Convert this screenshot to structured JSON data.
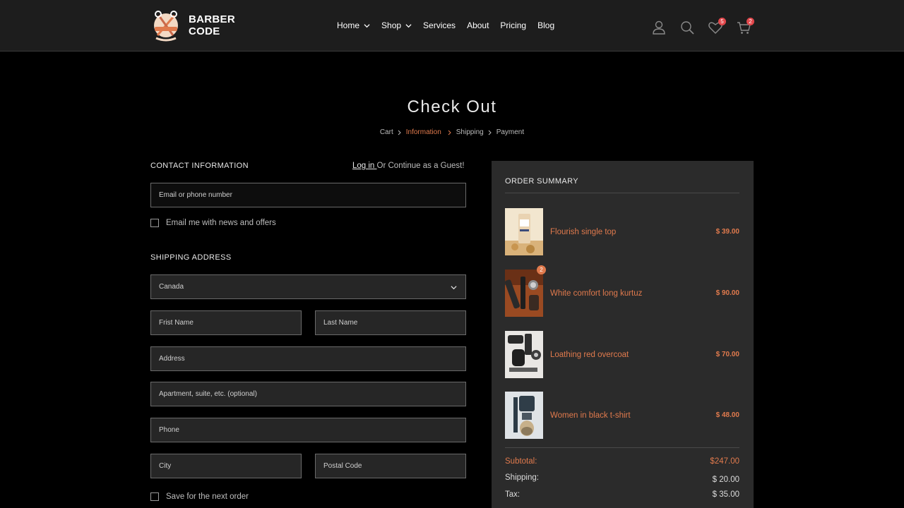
{
  "brand": {
    "line1": "BARBER",
    "line2": "CODE"
  },
  "nav": [
    {
      "label": "Home",
      "has_menu": true
    },
    {
      "label": "Shop",
      "has_menu": true
    },
    {
      "label": "Services",
      "has_menu": false
    },
    {
      "label": "About",
      "has_menu": false
    },
    {
      "label": "Pricing",
      "has_menu": false
    },
    {
      "label": "Blog",
      "has_menu": false
    }
  ],
  "header_actions": {
    "icons": [
      "user-icon",
      "search-icon",
      "heart-icon",
      "cart-icon"
    ],
    "wishlist_count": "5",
    "cart_count": "2"
  },
  "page": {
    "title": "Check Out",
    "breadcrumb": [
      "Cart",
      "Information",
      "Shipping",
      "Payment"
    ],
    "active_crumb": "Information"
  },
  "contact": {
    "heading": "CONTACT INFORMATION",
    "login_link": "Log in ",
    "guest_text": "Or Continue as a Guest!",
    "email_placeholder": "Email or phone number",
    "newsletter_label": "Email me with news and offers"
  },
  "shipping": {
    "heading": "SHIPPING ADDRESS",
    "country_value": "Canada",
    "first_name_placeholder": "Frist Name",
    "last_name_placeholder": "Last Name",
    "address_placeholder": "Address",
    "apartment_placeholder": "Apartment, suite, etc. (optional)",
    "phone_placeholder": "Phone",
    "city_placeholder": "City",
    "postal_placeholder": "Postal Code",
    "save_label": "Save for the next order"
  },
  "summary": {
    "heading": "ORDER SUMMARY",
    "items": [
      {
        "name": "Flourish single top",
        "price": "$ 39.00",
        "qty": ""
      },
      {
        "name": "White comfort long kurtuz",
        "price": "$ 90.00",
        "qty": "2"
      },
      {
        "name": "Loathing red overcoat",
        "price": "$ 70.00",
        "qty": ""
      },
      {
        "name": "Women in black t-shirt",
        "price": "$ 48.00",
        "qty": ""
      }
    ],
    "subtotal_label": "Subtotal:",
    "subtotal_value": "$247.00",
    "shipping_label": "Shipping:",
    "shipping_value": "$ 20.00",
    "tax_label": "Tax:",
    "tax_value": "$ 35.00"
  },
  "colors": {
    "accent": "#e07a4d",
    "badge": "#e2474b",
    "panel": "#2b2b2b",
    "header": "#1d1d1d"
  }
}
